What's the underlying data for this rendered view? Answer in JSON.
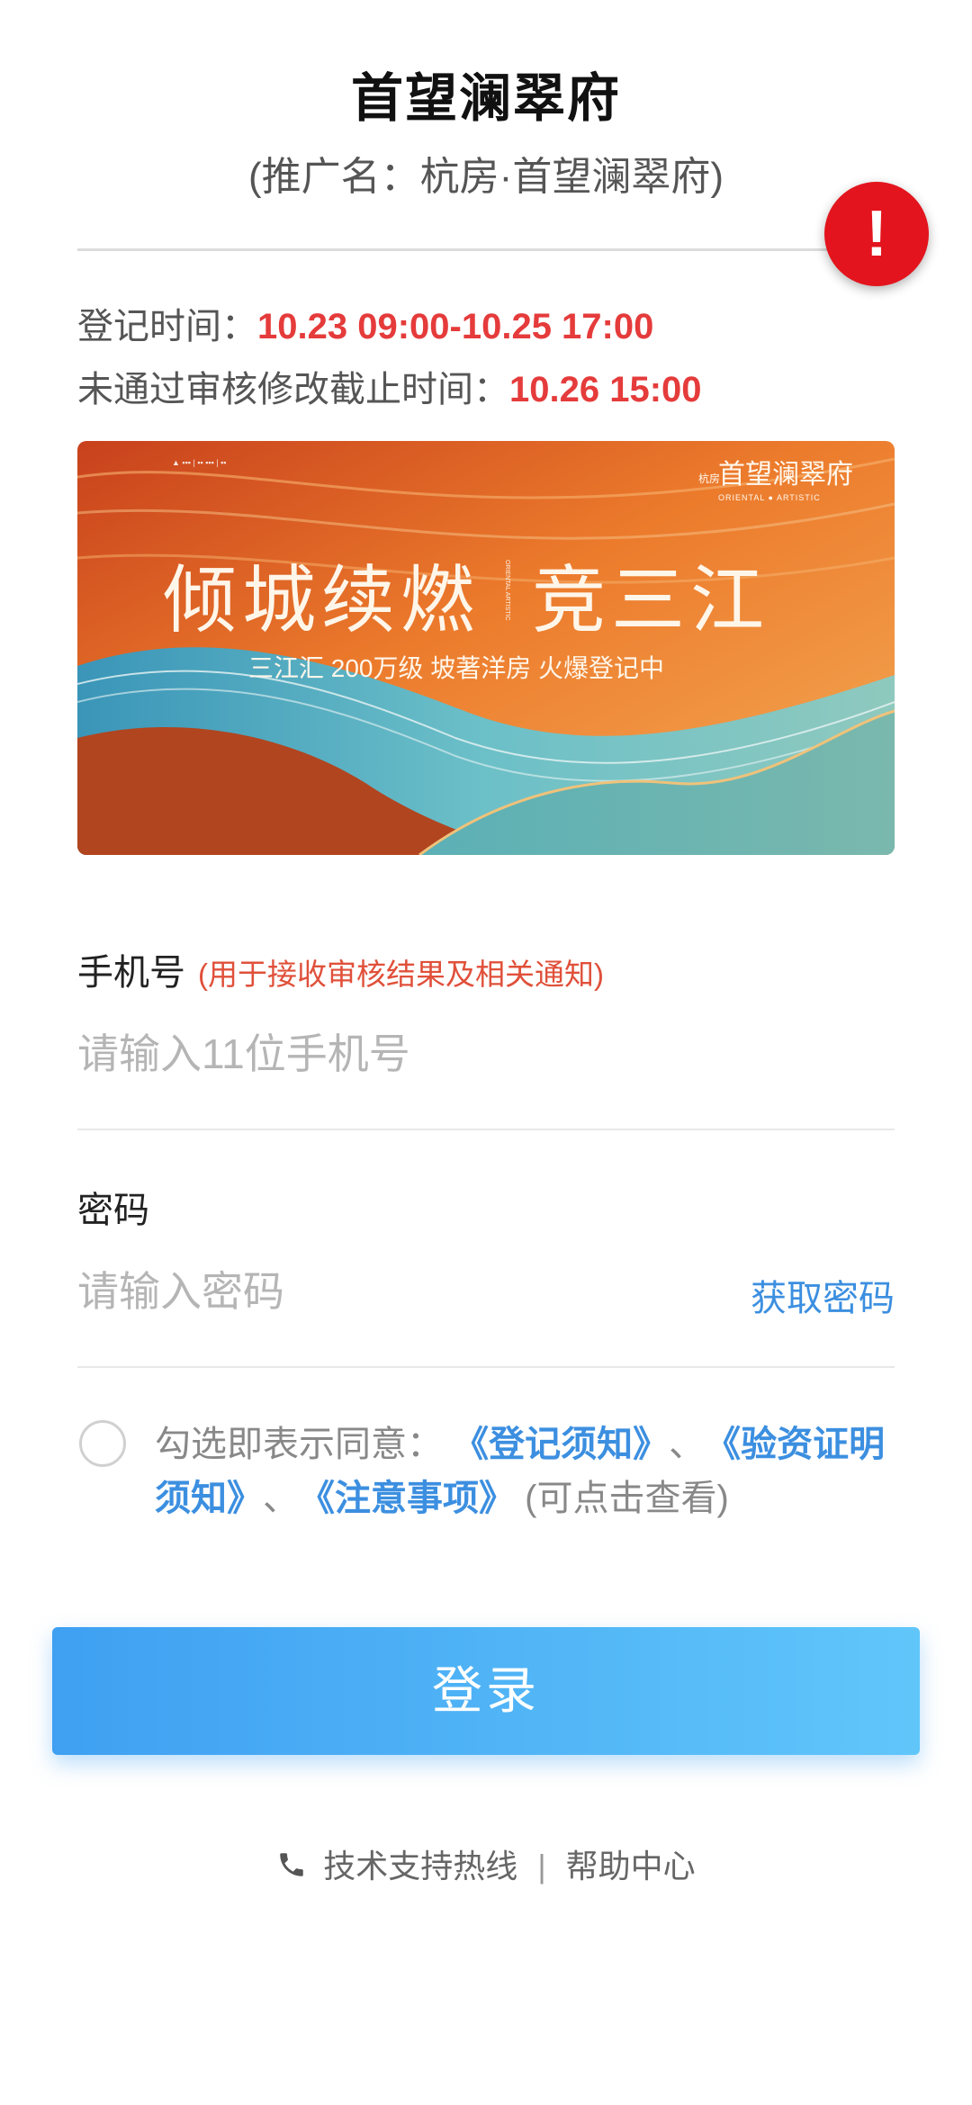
{
  "header": {
    "title": "首望澜翠府",
    "subtitle": "(推广名：杭房·首望澜翠府)"
  },
  "alert": {
    "symbol": "!",
    "icon": "exclamation-icon",
    "color": "#e3141d"
  },
  "info": {
    "reg_time_label": "登记时间：",
    "reg_time_value": "10.23 09:00-10.25 17:00",
    "deadline_label": "未通过审核修改截止时间：",
    "deadline_value": "10.26 15:00"
  },
  "banner": {
    "logo_text": "首望澜翠府",
    "logo_small": "杭房",
    "logo_sub": "ORIENTAL ● ARTISTIC",
    "headline_left": "倾城续燃",
    "headline_right": "竞三江",
    "vertical_text": "ORIENTAL ARTISTIC",
    "tagline": "三江汇 200万级 坡著洋房 火爆登记中"
  },
  "phone": {
    "label": "手机号",
    "hint": "(用于接收审核结果及相关通知)",
    "placeholder": "请输入11位手机号"
  },
  "password": {
    "label": "密码",
    "placeholder": "请输入密码",
    "get_label": "获取密码"
  },
  "agreement": {
    "prefix": "勾选即表示同意：",
    "link1": "《登记须知》",
    "sep1": "、",
    "link2": "《验资证明须知》",
    "sep2": "、",
    "link3": "《注意事项》",
    "suffix": "(可点击查看)"
  },
  "login": {
    "label": "登录"
  },
  "footer": {
    "support": "技术支持热线",
    "divider": "|",
    "help": "帮助中心"
  },
  "colors": {
    "accent_blue": "#3c8fe0",
    "highlight_red": "#e53b3b",
    "button_start": "#3fa0f2",
    "button_end": "#60c6fa"
  }
}
